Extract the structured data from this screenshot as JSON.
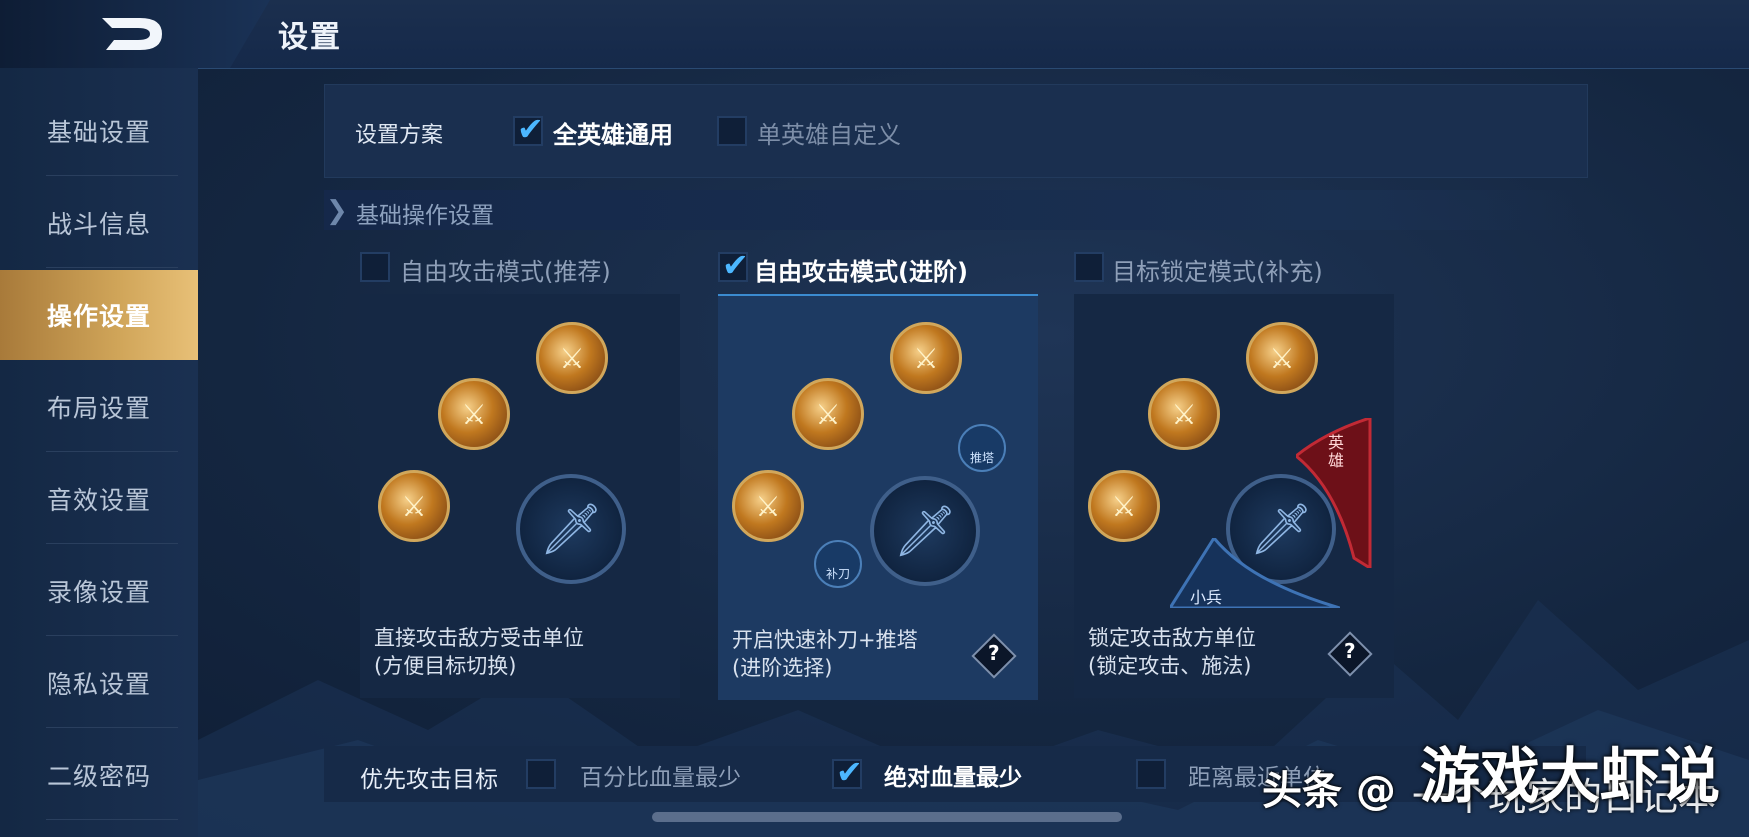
{
  "header": {
    "title": "设置"
  },
  "sidebar": {
    "items": [
      {
        "label": "基础设置",
        "active": false
      },
      {
        "label": "战斗信息",
        "active": false
      },
      {
        "label": "操作设置",
        "active": true
      },
      {
        "label": "布局设置",
        "active": false
      },
      {
        "label": "音效设置",
        "active": false
      },
      {
        "label": "录像设置",
        "active": false
      },
      {
        "label": "隐私设置",
        "active": false
      },
      {
        "label": "二级密码",
        "active": false
      }
    ]
  },
  "scheme": {
    "label": "设置方案",
    "options": [
      {
        "label": "全英雄通用",
        "checked": true
      },
      {
        "label": "单英雄自定义",
        "checked": false
      }
    ]
  },
  "section": {
    "title": "基础操作设置"
  },
  "modes": [
    {
      "label": "自由攻击模式(推荐)",
      "checked": false,
      "desc_line1": "直接攻击敌方受击单位",
      "desc_line2": "(方便目标切换)",
      "has_help": false
    },
    {
      "label": "自由攻击模式(进阶)",
      "checked": true,
      "desc_line1": "开启快速补刀+推塔",
      "desc_line2": "(进阶选择)",
      "has_help": true,
      "buttons": {
        "tower": "推塔",
        "lasthit": "补刀"
      }
    },
    {
      "label": "目标锁定模式(补充)",
      "checked": false,
      "desc_line1": "锁定攻击敌方单位",
      "desc_line2": "(锁定攻击、施法)",
      "has_help": true,
      "tabs": {
        "hero": "英雄",
        "minion": "小兵"
      }
    }
  ],
  "priority": {
    "label": "优先攻击目标",
    "options": [
      {
        "label": "百分比血量最少",
        "checked": false
      },
      {
        "label": "绝对血量最少",
        "checked": true
      },
      {
        "label": "距离最近单位",
        "checked": false
      }
    ]
  },
  "help_glyph": "?",
  "watermark": {
    "left": "头条 @",
    "right": "游戏大虾说",
    "partial": "一个玩家的日记本"
  },
  "colors": {
    "accent": "#4cb7ff",
    "active_tab": "#d0a559",
    "hero_red": "#b2242e"
  }
}
